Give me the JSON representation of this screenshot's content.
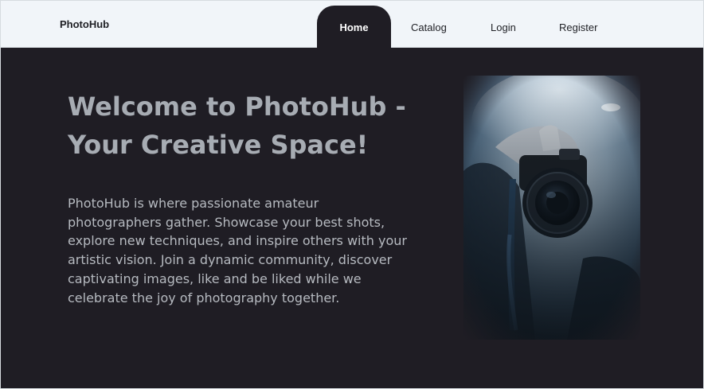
{
  "navbar": {
    "brand": "PhotoHub",
    "links": [
      {
        "label": "Home",
        "active": true
      },
      {
        "label": "Catalog"
      },
      {
        "label": "Login"
      },
      {
        "label": "Register"
      }
    ]
  },
  "hero": {
    "title": "Welcome to PhotoHub - Your Creative Space!",
    "description": "PhotoHub is where passionate amateur photographers gather. Showcase your best shots, explore new techniques, and inspire others with your artistic vision. Join a dynamic community, discover captivating images, like and be liked while we celebrate the joy of photography together.",
    "image_subject": "person-holding-camera-in-smoke"
  },
  "colors": {
    "background_dark": "#1f1d24",
    "navbar_bg": "#f1f5f9",
    "title_text": "#a7acb3",
    "body_text": "#b6bac0",
    "active_tab_text": "#ffffff"
  }
}
